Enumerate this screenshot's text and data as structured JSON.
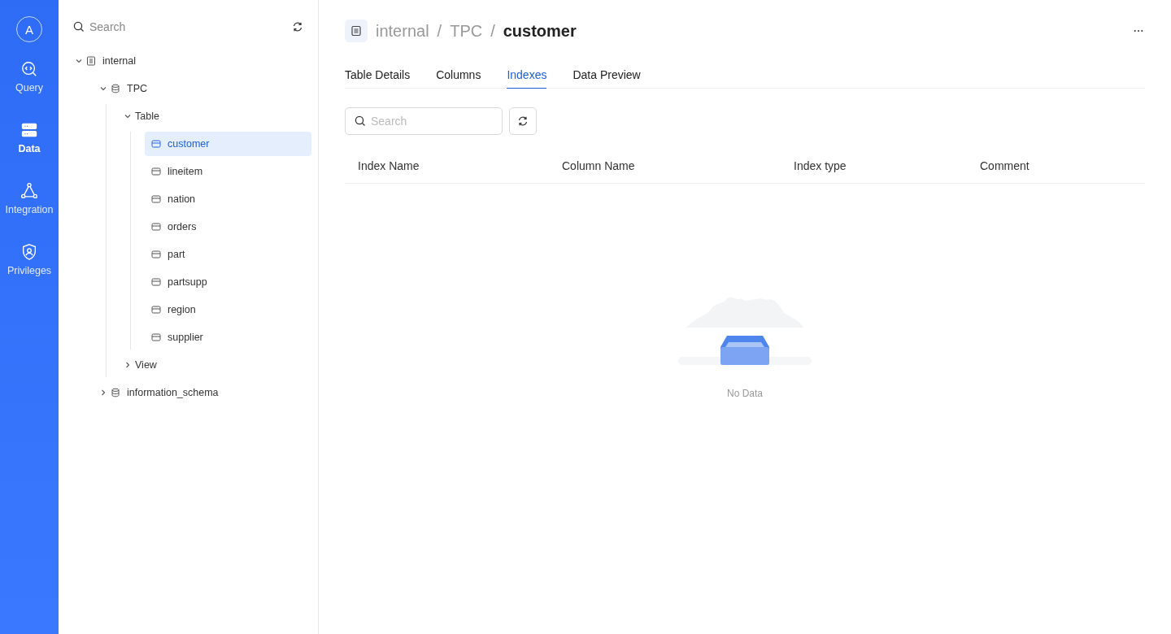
{
  "sidebar": {
    "avatar": "A",
    "items": [
      {
        "label": "Query",
        "selected": false
      },
      {
        "label": "Data",
        "selected": true
      },
      {
        "label": "Integration",
        "selected": false
      },
      {
        "label": "Privileges",
        "selected": false
      }
    ]
  },
  "explorer": {
    "search": {
      "placeholder": "Search"
    },
    "tree": [
      {
        "kind": "catalog",
        "label": "internal",
        "expanded": true,
        "children": [
          {
            "kind": "database",
            "label": "TPC",
            "expanded": true,
            "children": [
              {
                "kind": "folder",
                "label": "Table",
                "expanded": true,
                "children": [
                  {
                    "kind": "table",
                    "label": "customer",
                    "selected": true
                  },
                  {
                    "kind": "table",
                    "label": "lineitem",
                    "selected": false
                  },
                  {
                    "kind": "table",
                    "label": "nation",
                    "selected": false
                  },
                  {
                    "kind": "table",
                    "label": "orders",
                    "selected": false
                  },
                  {
                    "kind": "table",
                    "label": "part",
                    "selected": false
                  },
                  {
                    "kind": "table",
                    "label": "partsupp",
                    "selected": false
                  },
                  {
                    "kind": "table",
                    "label": "region",
                    "selected": false
                  },
                  {
                    "kind": "table",
                    "label": "supplier",
                    "selected": false
                  }
                ]
              },
              {
                "kind": "folder",
                "label": "View",
                "expanded": false
              }
            ]
          },
          {
            "kind": "database",
            "label": "information_schema",
            "expanded": false
          }
        ]
      }
    ]
  },
  "breadcrumb": {
    "separator": "/",
    "items": [
      "internal",
      "TPC",
      "customer"
    ]
  },
  "tabs": [
    {
      "label": "Table Details",
      "selected": false
    },
    {
      "label": "Columns",
      "selected": false
    },
    {
      "label": "Indexes",
      "selected": true
    },
    {
      "label": "Data Preview",
      "selected": false
    }
  ],
  "index_search": {
    "placeholder": "Search"
  },
  "table": {
    "columns": [
      "Index Name",
      "Column Name",
      "Index type",
      "Comment"
    ],
    "empty_text": "No Data"
  }
}
